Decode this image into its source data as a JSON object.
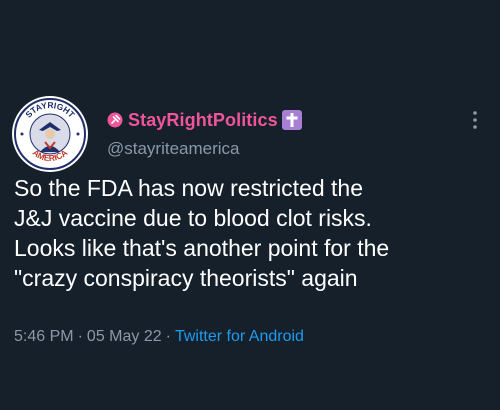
{
  "tweet": {
    "author": {
      "display_name": "StayRightPolitics",
      "handle": "@stayriteamerica",
      "avatar": {
        "top_text": "STAYRIGHT",
        "bottom_text": "AMERICA",
        "icon": "patriot-emblem-icon"
      },
      "name_prefix_icon": "pin-icon",
      "name_suffix_icon": "latin-cross-icon"
    },
    "text": "So the FDA has now restricted the\nJ&J vaccine due to blood clot risks.\nLooks like that's another point for the\n\"crazy conspiracy theorists\" again",
    "time": "5:46 PM",
    "date": "05 May 22",
    "separator": "·",
    "source": "Twitter for Android",
    "menu_icon": "more-vertical-icon"
  },
  "colors": {
    "background": "#15202b",
    "name": "#f0559a",
    "secondary_text": "#8b98a5",
    "link": "#1d9bf0",
    "badge": "#a97fd6"
  }
}
